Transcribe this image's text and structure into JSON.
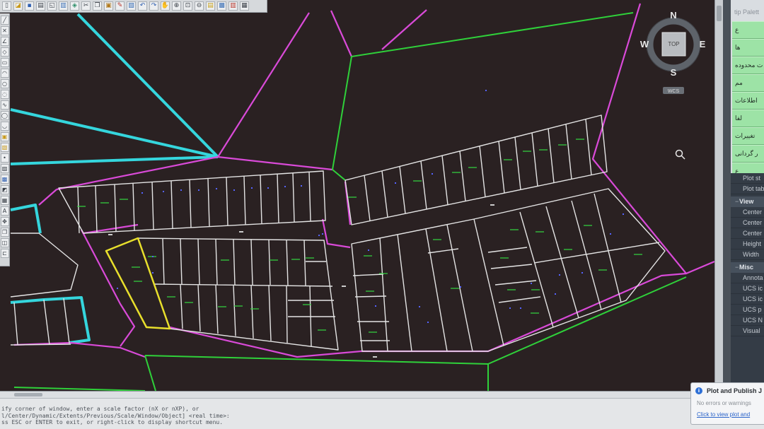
{
  "toolbar_top": {
    "icons": [
      "new-icon",
      "open-icon",
      "save-icon",
      "plot-icon",
      "plot-preview-icon",
      "publish-icon",
      "3d-dwf-icon",
      "cut-icon",
      "copy-icon",
      "paste-icon",
      "match-properties-icon",
      "block-editor-icon",
      "undo-icon",
      "redo-icon",
      "pan-icon",
      "zoom-realtime-icon",
      "zoom-window-icon",
      "zoom-previous-icon",
      "properties-icon",
      "design-center-icon",
      "tool-palettes-icon",
      "quickcalc-icon"
    ]
  },
  "toolbar_left": {
    "icons": [
      "line-icon",
      "construction-line-icon",
      "polyline-icon",
      "polygon-icon",
      "rectangle-icon",
      "arc-icon",
      "circle-icon",
      "revision-cloud-icon",
      "spline-icon",
      "ellipse-icon",
      "ellipse-arc-icon",
      "insert-block-icon",
      "make-block-icon",
      "point-icon",
      "hatch-icon",
      "gradient-icon",
      "region-icon",
      "table-icon",
      "multiline-text-icon",
      "move-icon",
      "copy-object-icon",
      "mirror-icon",
      "offset-icon"
    ]
  },
  "viewcube": {
    "north": "N",
    "south": "S",
    "east": "E",
    "west": "W",
    "face": "TOP",
    "ucs": "WCS"
  },
  "drawing": {
    "background": "#2a2122",
    "colors": {
      "boundary_cyan": "#35d6dd",
      "road_magenta": "#d94ad8",
      "zone_green": "#2fd13a",
      "parcel_white": "#e4e4e4",
      "selected_yellow": "#e8df2c",
      "point_blue": "#5563ff"
    }
  },
  "tool_palette": {
    "title": "tip Palett",
    "buttons": [
      "ع",
      "ها",
      "ت محدوده",
      "مم",
      "اطلاعات",
      "لفا",
      "تغییرات",
      "ر گردانی",
      "ع"
    ]
  },
  "properties": {
    "top_rows": [
      "Plot st",
      "Plot tab"
    ],
    "sections": [
      {
        "title": "View",
        "rows": [
          "Center",
          "Center",
          "Center",
          "Height",
          "Width"
        ]
      },
      {
        "title": "Misc",
        "rows": [
          "Annota",
          "UCS ic",
          "UCS ic",
          "UCS p",
          "UCS N",
          "Visual"
        ]
      }
    ]
  },
  "command_line": {
    "lines": [
      "ify corner of window, enter a scale factor (nX or nXP), or",
      "l/Center/Dynamic/Extents/Previous/Scale/Window/Object] <real time>:",
      "ss ESC or ENTER to exit, or right-click to display shortcut menu."
    ]
  },
  "notification": {
    "title": "Plot and Publish J",
    "message": "No errors or warnings",
    "link": "Click to view plot and"
  }
}
